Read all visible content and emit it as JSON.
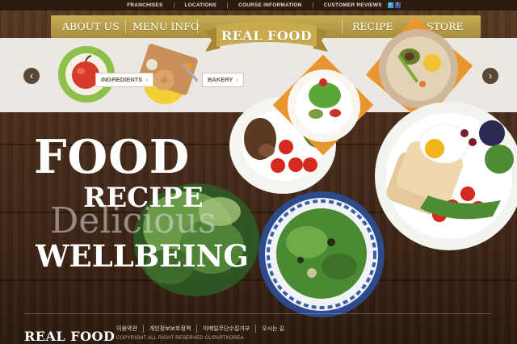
{
  "utility_links": [
    "FRANCHISES",
    "LOCATIONS",
    "COURSE INFORMATION",
    "CUSTOMER REVIEWS"
  ],
  "social": {
    "twitter": "t",
    "facebook": "f"
  },
  "nav": {
    "about": "ABOUT US",
    "menu": "MENU INFO",
    "recipe": "RECIPE",
    "store": "STORE"
  },
  "logo": "REAL FOOD",
  "slider": {
    "ingredients_label": "INGREDIENTS",
    "bakery_label": "BAKERY",
    "prev_icon": "chevron-left-icon",
    "next_icon": "chevron-right-icon"
  },
  "hero": {
    "line1": "FOOD",
    "line2": "RECIPE",
    "line3": "Delicious",
    "line4": "WELLBEING"
  },
  "footer": {
    "logo": "REAL FOOD",
    "links": [
      "이용약관",
      "개인정보보호정책",
      "이메일무단수집거부",
      "오시는 길"
    ],
    "copyright": "COPYRIGHT ALL RIGHT RESERVED CLIPARTKOREA"
  },
  "colors": {
    "nav_gold": "#b8993f",
    "ribbon_gold": "#c9ab4d",
    "wood": "#4a2e1c",
    "accent_orange": "#e9962f"
  }
}
